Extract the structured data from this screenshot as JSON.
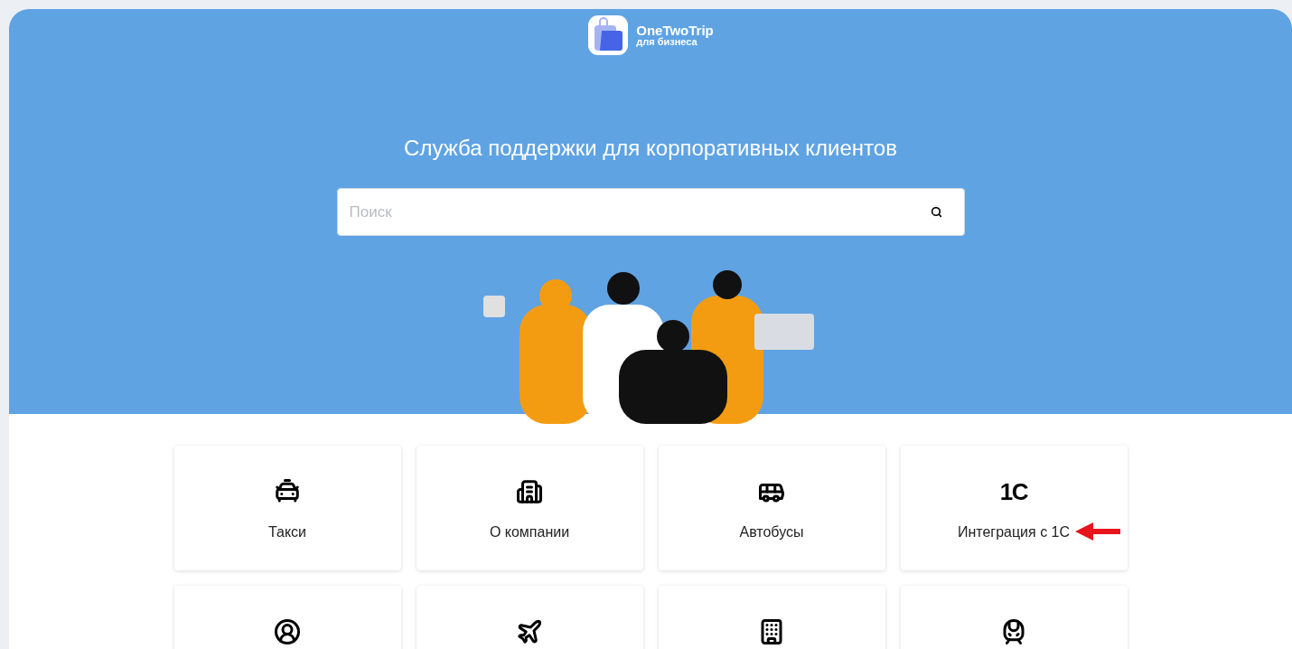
{
  "logo": {
    "name": "OneTwoTrip",
    "subtitle": "для бизнеса"
  },
  "hero": {
    "title": "Служба поддержки для корпоративных клиентов"
  },
  "search": {
    "placeholder": "Поиск"
  },
  "categories": [
    {
      "kind": "icon",
      "label": "Такси"
    },
    {
      "kind": "icon",
      "label": "О компании"
    },
    {
      "kind": "icon",
      "label": "Автобусы"
    },
    {
      "kind": "logo",
      "label": "Интеграция с 1С",
      "logo_text": "1С"
    },
    {
      "kind": "icon"
    },
    {
      "kind": "icon"
    },
    {
      "kind": "icon"
    },
    {
      "kind": "icon"
    }
  ]
}
